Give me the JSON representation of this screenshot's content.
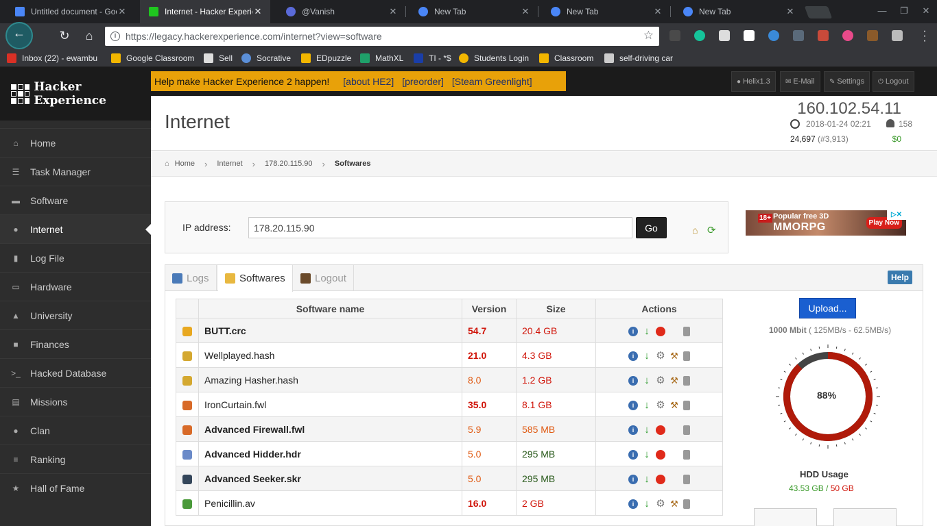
{
  "browser": {
    "tabs": [
      {
        "title": "Untitled document - Goo",
        "color": "#4a86f7"
      },
      {
        "title": "Internet - Hacker Experie",
        "color": "#1fc61f"
      },
      {
        "title": "@Vanish",
        "color": "#5a6ad8"
      },
      {
        "title": "New Tab",
        "color": "#4a86f7"
      },
      {
        "title": "New Tab",
        "color": "#4a86f7"
      },
      {
        "title": "New Tab",
        "color": "#4a86f7"
      }
    ],
    "url_host": "https://legacy.hackerexperience.com",
    "url_path": "/internet?view=software",
    "bookmarks": [
      {
        "label": "Inbox (22) - ewambu",
        "color": "#d93025"
      },
      {
        "label": "Google Classroom",
        "color": "#f2b600"
      },
      {
        "label": "Sell",
        "color": "#dddddd"
      },
      {
        "label": "Socrative",
        "color": "#5b8fd8"
      },
      {
        "label": "EDpuzzle",
        "color": "#f2b600"
      },
      {
        "label": "MathXL",
        "color": "#1fa06a"
      },
      {
        "label": "TI - *$",
        "color": "#1a3ea8"
      },
      {
        "label": "Students Login",
        "color": "#f2b600"
      },
      {
        "label": "Classroom",
        "color": "#f2b600"
      },
      {
        "label": "self-driving car",
        "color": "#cccccc"
      }
    ]
  },
  "site": {
    "logo_text": "Hacker Experience",
    "banner": {
      "text": "Help make Hacker Experience 2 happen!",
      "links": [
        "[about HE2]",
        "[preorder]",
        "[Steam Greenlight]"
      ]
    },
    "top_buttons": [
      "Helix1.3",
      "E-Mail",
      "Settings",
      "Logout"
    ],
    "sidebar": [
      {
        "label": "Home",
        "icon": "home-icon",
        "glyph": "⌂"
      },
      {
        "label": "Task Manager",
        "icon": "tasks-icon",
        "glyph": "☰"
      },
      {
        "label": "Software",
        "icon": "folder-icon",
        "glyph": "▬"
      },
      {
        "label": "Internet",
        "icon": "globe-icon",
        "glyph": "●"
      },
      {
        "label": "Log File",
        "icon": "book-icon",
        "glyph": "▮"
      },
      {
        "label": "Hardware",
        "icon": "desktop-icon",
        "glyph": "▭"
      },
      {
        "label": "University",
        "icon": "flask-icon",
        "glyph": "▲"
      },
      {
        "label": "Finances",
        "icon": "briefcase-icon",
        "glyph": "■"
      },
      {
        "label": "Hacked Database",
        "icon": "terminal-icon",
        "glyph": ">_"
      },
      {
        "label": "Missions",
        "icon": "list-icon",
        "glyph": "▤"
      },
      {
        "label": "Clan",
        "icon": "group-icon",
        "glyph": "●"
      },
      {
        "label": "Ranking",
        "icon": "bars-icon",
        "glyph": "≡"
      },
      {
        "label": "Hall of Fame",
        "icon": "star-icon",
        "glyph": "★"
      }
    ],
    "active_section": "Internet"
  },
  "header": {
    "title": "Internet",
    "ip": "160.102.54.11",
    "datetime": "2018-01-24 02:21",
    "online": "158",
    "reputation": "24,697",
    "rank": "(#3,913)",
    "money": "$0"
  },
  "breadcrumb": [
    "Home",
    "Internet",
    "178.20.115.90",
    "Softwares"
  ],
  "ipform": {
    "label": "IP address:",
    "value": "178.20.115.90",
    "go": "Go"
  },
  "ad": {
    "line1": "Popular free 3D",
    "line2": "MMORPG",
    "cta": "Play Now",
    "age": "18+"
  },
  "tabs": [
    "Logs",
    "Softwares",
    "Logout"
  ],
  "help_label": "Help",
  "table": {
    "headers": [
      "Software name",
      "Version",
      "Size",
      "Actions"
    ],
    "rows": [
      {
        "name": "BUTT.crc",
        "version": "54.7",
        "size": "20.4 GB",
        "icon": "key-icon",
        "color": "#e8a820",
        "bold": true,
        "vcls": "redb",
        "scls": "red",
        "acts": [
          "info",
          "dl",
          "run",
          "none",
          "del"
        ]
      },
      {
        "name": "Wellplayed.hash",
        "version": "21.0",
        "size": "4.3 GB",
        "icon": "lock-icon",
        "color": "#d4a830",
        "bold": false,
        "vcls": "redb",
        "scls": "red",
        "acts": [
          "info",
          "dl",
          "gear",
          "crack",
          "del"
        ]
      },
      {
        "name": "Amazing Hasher.hash",
        "version": "8.0",
        "size": "1.2 GB",
        "icon": "lock-icon",
        "color": "#d4a830",
        "bold": false,
        "vcls": "org",
        "scls": "red",
        "acts": [
          "info",
          "dl",
          "gear",
          "crack",
          "del"
        ]
      },
      {
        "name": "IronCurtain.fwl",
        "version": "35.0",
        "size": "8.1 GB",
        "icon": "firewall-icon",
        "color": "#d86a28",
        "bold": false,
        "vcls": "redb",
        "scls": "red",
        "acts": [
          "info",
          "dl",
          "gear",
          "crack",
          "del"
        ]
      },
      {
        "name": "Advanced Firewall.fwl",
        "version": "5.9",
        "size": "585 MB",
        "icon": "firewall-icon",
        "color": "#d86a28",
        "bold": true,
        "vcls": "org",
        "scls": "org",
        "acts": [
          "info",
          "dl",
          "run",
          "none",
          "del"
        ]
      },
      {
        "name": "Advanced Hidder.hdr",
        "version": "5.0",
        "size": "295 MB",
        "icon": "eye-icon",
        "color": "#6a8ac8",
        "bold": true,
        "vcls": "org",
        "scls": "dgr",
        "acts": [
          "info",
          "dl",
          "run",
          "none",
          "del"
        ]
      },
      {
        "name": "Advanced Seeker.skr",
        "version": "5.0",
        "size": "295 MB",
        "icon": "binoculars-icon",
        "color": "#34465a",
        "bold": true,
        "vcls": "org",
        "scls": "dgr",
        "acts": [
          "info",
          "dl",
          "run",
          "none",
          "del"
        ]
      },
      {
        "name": "Penicillin.av",
        "version": "16.0",
        "size": "2 GB",
        "icon": "bug-icon",
        "color": "#4a9a3a",
        "bold": false,
        "vcls": "redb",
        "scls": "red",
        "acts": [
          "info",
          "dl",
          "gear",
          "crack",
          "del"
        ]
      }
    ]
  },
  "upload": {
    "label": "Upload...",
    "speed_bold": "1000 Mbit",
    "speed_rest": "( 125MB/s - 62.5MB/s)"
  },
  "hdd": {
    "percent": 88,
    "percent_label": "88%",
    "title": "HDD Usage",
    "used": "43.53 GB",
    "total": "50 GB"
  },
  "colors": {
    "banner": "#e8a109",
    "gauge_used": "#b01a0a",
    "gauge_free": "#444444",
    "upload": "#1a5fd0"
  }
}
